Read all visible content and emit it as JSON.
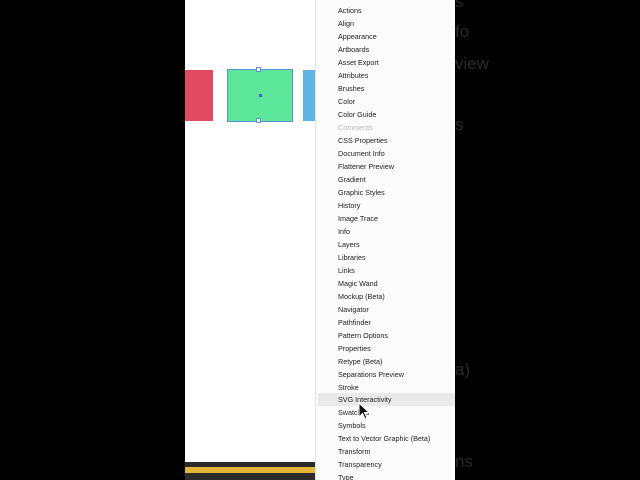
{
  "window_menu": {
    "items": [
      {
        "label": "Actions"
      },
      {
        "label": "Align"
      },
      {
        "label": "Appearance"
      },
      {
        "label": "Artboards"
      },
      {
        "label": "Asset Export"
      },
      {
        "label": "Attributes"
      },
      {
        "label": "Brushes"
      },
      {
        "label": "Color"
      },
      {
        "label": "Color Guide"
      },
      {
        "label": "Comments",
        "disabled": true
      },
      {
        "label": "CSS Properties"
      },
      {
        "label": "Document Info"
      },
      {
        "label": "Flattener Preview"
      },
      {
        "label": "Gradient"
      },
      {
        "label": "Graphic Styles"
      },
      {
        "label": "History"
      },
      {
        "label": "Image Trace"
      },
      {
        "label": "Info"
      },
      {
        "label": "Layers"
      },
      {
        "label": "Libraries"
      },
      {
        "label": "Links"
      },
      {
        "label": "Magic Wand"
      },
      {
        "label": "Mockup (Beta)"
      },
      {
        "label": "Navigator"
      },
      {
        "label": "Pathfinder"
      },
      {
        "label": "Pattern Options"
      },
      {
        "label": "Properties"
      },
      {
        "label": "Retype (Beta)"
      },
      {
        "label": "Separations Preview"
      },
      {
        "label": "Stroke"
      },
      {
        "label": "SVG Interactivity",
        "hovered": true
      },
      {
        "label": "Swatches"
      },
      {
        "label": "Symbols"
      },
      {
        "label": "Text to Vector Graphic (Beta)"
      },
      {
        "label": "Transform"
      },
      {
        "label": "Transparency"
      },
      {
        "label": "Type"
      }
    ]
  },
  "artboard": {
    "shapes": [
      {
        "name": "red-rectangle",
        "color": "#e24a61"
      },
      {
        "name": "green-rectangle",
        "color": "#5be69a",
        "selected": true
      },
      {
        "name": "blue-rectangle",
        "color": "#5fb4e6"
      }
    ],
    "selection_color": "#5b8fd6"
  },
  "background_colors": {
    "accent": "#e3b63a"
  }
}
